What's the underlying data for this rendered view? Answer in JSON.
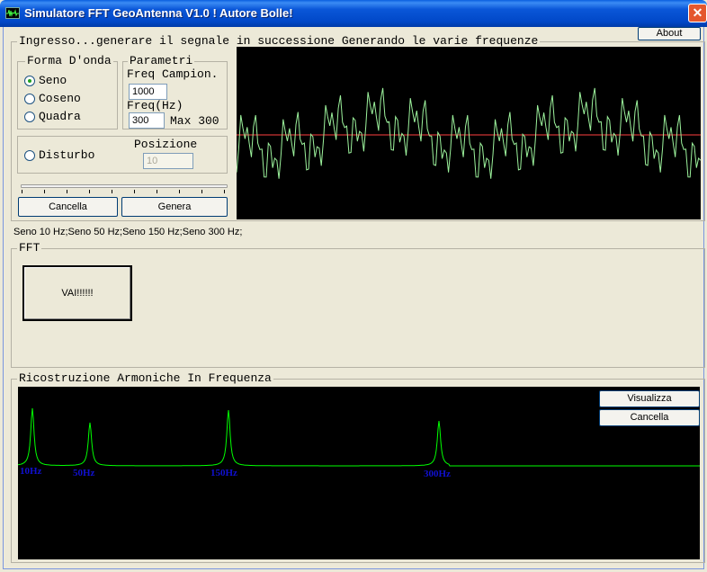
{
  "window": {
    "title": "Simulatore FFT GeoAntenna V1.0 ! Autore Bolle!",
    "close_glyph": "✕"
  },
  "about_label": "About",
  "input_group": {
    "legend": "Ingresso...generare il segnale in successione Generando le varie frequenze",
    "waveform": {
      "legend": "Forma D'onda",
      "options": [
        "Seno",
        "Coseno",
        "Quadra"
      ],
      "selected": "Seno"
    },
    "params": {
      "legend": "Parametri",
      "sample_label": "Freq Campion.",
      "sample_value": "1000",
      "freq_label": "Freq(Hz)",
      "freq_value": "300",
      "max_label": "Max 300"
    },
    "noise": {
      "label": "Disturbo",
      "position_label": "Posizione",
      "position_value": "10"
    },
    "cancel_label": "Cancella",
    "generate_label": "Genera"
  },
  "signal_summary": "Seno 10 Hz;Seno 50 Hz;Seno 150 Hz;Seno 300 Hz;",
  "fft_group": {
    "legend": "FFT",
    "run_label": "VAI!!!!!!"
  },
  "harmonics_group": {
    "legend": "Ricostruzione Armoniche In Frequenza",
    "show_label": "Visualizza",
    "cancel_label": "Cancella",
    "peak_labels": [
      "10Hz",
      "50Hz",
      "150Hz",
      "300Hz"
    ]
  },
  "colors": {
    "scope_bg": "#000000",
    "trace": "#9cf29c",
    "baseline": "#ff4040",
    "peak_label": "#1010d0",
    "spectrum": "#00ff00"
  }
}
